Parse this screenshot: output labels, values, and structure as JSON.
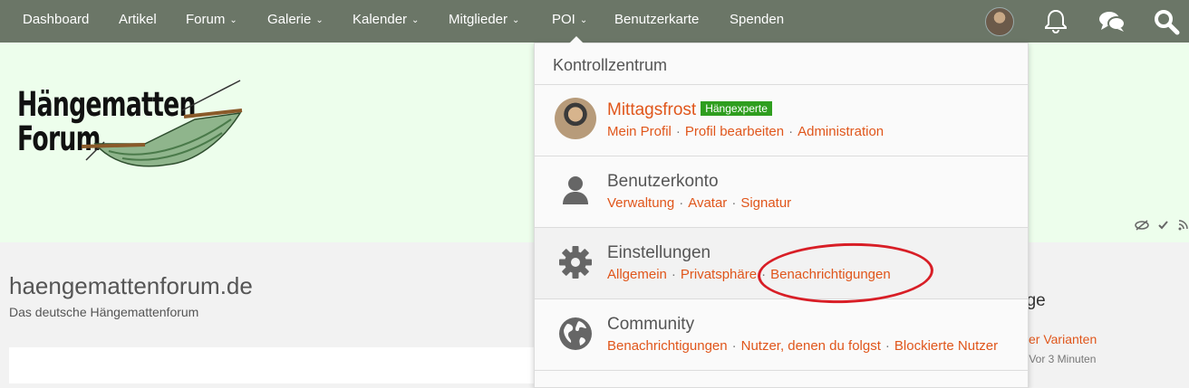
{
  "nav": {
    "items": [
      {
        "label": "Dashboard",
        "dropdown": false
      },
      {
        "label": "Artikel",
        "dropdown": false
      },
      {
        "label": "Forum",
        "dropdown": true
      },
      {
        "label": "Galerie",
        "dropdown": true
      },
      {
        "label": "Kalender",
        "dropdown": true
      },
      {
        "label": "Mitglieder",
        "dropdown": true
      },
      {
        "label": "POI",
        "dropdown": true
      },
      {
        "label": "Benutzerkarte",
        "dropdown": false
      },
      {
        "label": "Spenden",
        "dropdown": false
      }
    ],
    "icons": [
      "user-avatar",
      "bell-icon",
      "chat-bubbles-icon",
      "search-icon"
    ]
  },
  "header": {
    "logo_line1": "Hängematten",
    "logo_line2": "Forum"
  },
  "main": {
    "title": "haengemattenforum.de",
    "subtitle": "Das deutsche Hängemattenforum",
    "sidebar_fragment": "äge",
    "sidebar_link": "ver Varianten",
    "sidebar_meta": "· Vor 3 Minuten"
  },
  "panel": {
    "title": "Kontrollzentrum",
    "user": {
      "name": "Mittagsfrost",
      "badge": "Hängexperte",
      "links": [
        "Mein Profil",
        "Profil bearbeiten",
        "Administration"
      ]
    },
    "account": {
      "title": "Benutzerkonto",
      "links": [
        "Verwaltung",
        "Avatar",
        "Signatur"
      ]
    },
    "settings": {
      "title": "Einstellungen",
      "links": [
        "Allgemein",
        "Privatsphäre",
        "Benachrichtigungen"
      ]
    },
    "community": {
      "title": "Community",
      "links": [
        "Benachrichtigungen",
        "Nutzer, denen du folgst",
        "Blockierte Nutzer"
      ]
    }
  },
  "colors": {
    "topbar": "#6b7667",
    "header_bg": "#edfeec",
    "link": "#e0561b",
    "badge": "#2f9e1f",
    "annotation": "#d81e26"
  }
}
